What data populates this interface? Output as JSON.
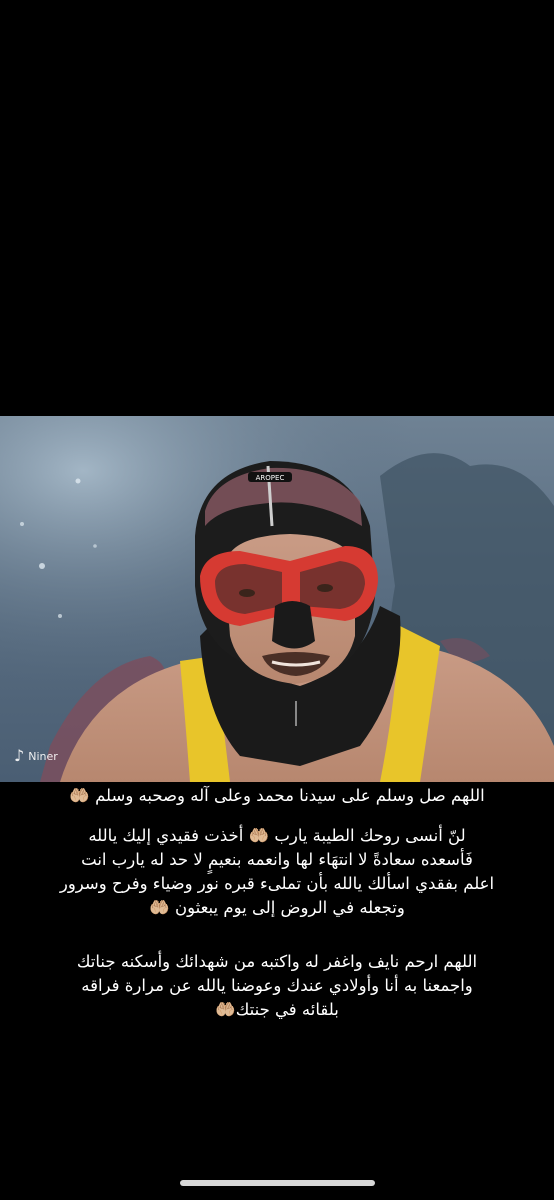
{
  "watermark": {
    "logo_glyph": "♪",
    "label": "Niner"
  },
  "photo": {
    "description_icon": "photo-icon",
    "mask_brand": "AROPEC"
  },
  "caption": {
    "line1": "اللهم صل وسلم على سيدنا محمد وعلى آله وصحبه وسلم 🤲🏼",
    "block1": [
      "لنّ أنسى روحك الطيبة يارب 🤲🏼 أخذت فقيدي إليك يالله",
      "فَأسعده سعادةً لا انتهَاء لها وانعمه بنعيمٍ لا حد له يارب انت",
      "اعلم بفقدي اسألك يالله بأن تملىء قبره نور وضياء وفرح وسرور",
      "وتجعله في الروض إلى يوم يبعثون 🤲🏼"
    ],
    "block2": [
      "اللهم ارحم نايف واغفر له واكتبه من شهدائك وأسكنه جناتك",
      "واجمعنا به أنا وأولادي عندك وعوضنا يالله عن مرارة فراقه",
      "بلقائه في جنتك🤲🏼"
    ]
  },
  "colors": {
    "background": "#000000",
    "text": "#ffffff",
    "water": "#5a6e82",
    "shirt": "#e8c52a",
    "mask": "#d63a32"
  }
}
